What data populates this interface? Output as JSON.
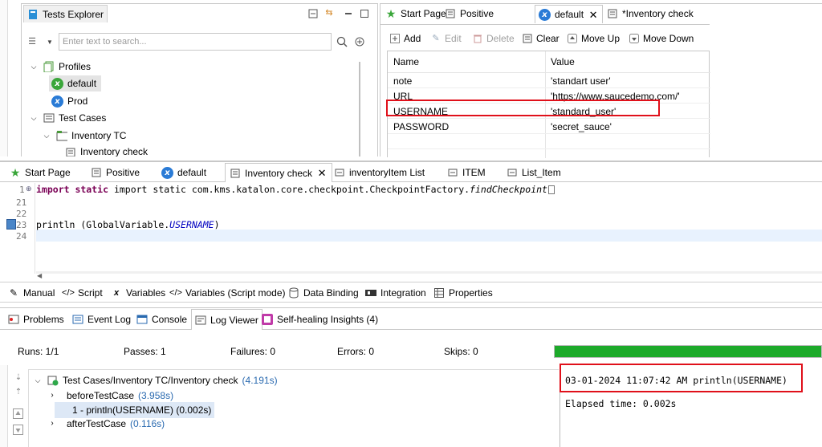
{
  "tests_explorer": {
    "title": "Tests Explorer",
    "search_placeholder": "Enter text to search...",
    "tree": {
      "profiles": "Profiles",
      "default": "default",
      "prod": "Prod",
      "test_cases": "Test Cases",
      "inventory_tc": "Inventory TC",
      "inventory_check": "Inventory check"
    }
  },
  "profile_editor": {
    "tabs": [
      "Start Page",
      "Positive",
      "default",
      "*Inventory check"
    ],
    "toolbar": {
      "add": "Add",
      "edit": "Edit",
      "delete": "Delete",
      "clear": "Clear",
      "move_up": "Move Up",
      "move_down": "Move Down"
    },
    "columns": {
      "name": "Name",
      "value": "Value"
    },
    "rows": [
      {
        "name": "note",
        "value": "'standart user'"
      },
      {
        "name": "URL",
        "value": "'https://www.saucedemo.com/'"
      },
      {
        "name": "USERNAME",
        "value": "'standard_user'"
      },
      {
        "name": "PASSWORD",
        "value": "'secret_sauce'"
      }
    ]
  },
  "editor": {
    "tabs": [
      "Start Page",
      "Positive",
      "default",
      "Inventory check",
      "inventoryItem List",
      "ITEM",
      "List_Item"
    ],
    "lines": [
      {
        "num": "1",
        "code": "import static com.kms.katalon.core.checkpoint.CheckpointFactory.",
        "italic": "findCheckpoint"
      },
      {
        "num": "21",
        "code": ""
      },
      {
        "num": "22",
        "code": ""
      },
      {
        "num": "23",
        "code": "println (GlobalVariable.",
        "italic": "USERNAME",
        "tail": ")"
      },
      {
        "num": "24",
        "code": ""
      }
    ],
    "bottom_tabs": [
      "Manual",
      "Script",
      "Variables",
      "Variables (Script mode)",
      "Data Binding",
      "Integration",
      "Properties"
    ]
  },
  "bottom_panel": {
    "tabs": [
      "Problems",
      "Event Log",
      "Console",
      "Log Viewer",
      "Self-healing Insights (4)"
    ],
    "stats": {
      "runs": "Runs: 1/1",
      "passes": "Passes: 1",
      "failures": "Failures: 0",
      "errors": "Errors: 0",
      "skips": "Skips: 0"
    },
    "progress": 1.0,
    "progress_color": "#1daa2a",
    "log_tree": {
      "root": "Test Cases/Inventory TC/Inventory check",
      "root_time": "(4.191s)",
      "before": "beforeTestCase",
      "before_time": "(3.958s)",
      "step": "1 - println(USERNAME) (0.002s)",
      "after": "afterTestCase",
      "after_time": "(0.116s)"
    },
    "console": {
      "line1": "03-01-2024 11:07:42 AM println(USERNAME)",
      "line2": "Elapsed time: 0.002s"
    }
  }
}
